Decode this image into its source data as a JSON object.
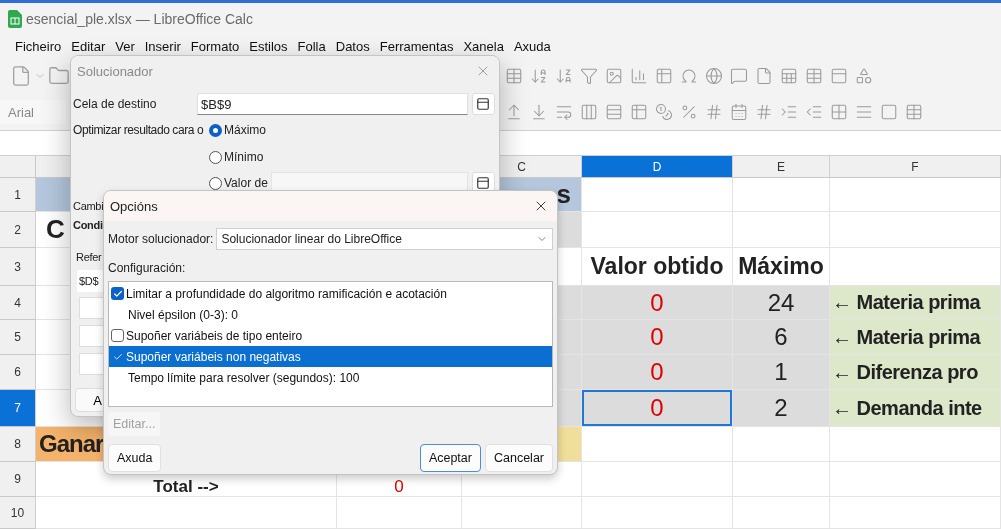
{
  "window": {
    "title": "esencial_ple.xlsx — LibreOffice Calc"
  },
  "menu": [
    "Ficheiro",
    "Editar",
    "Ver",
    "Inserir",
    "Formato",
    "Estilos",
    "Folla",
    "Datos",
    "Ferramentas",
    "Xanela",
    "Axuda"
  ],
  "font_name": {
    "value": "Arial"
  },
  "sheet": {
    "columns": [
      {},
      {},
      {
        "label": "C",
        "selected": false
      },
      {
        "label": "D",
        "selected": true
      },
      {
        "label": "E",
        "selected": false
      },
      {
        "label": "F",
        "selected": false
      }
    ],
    "rows": [
      {
        "label": "1",
        "selected": false,
        "cells": [
          {
            "kind": "band"
          },
          {
            "kind": "band"
          },
          {
            "kind": "band",
            "text": "s"
          },
          {
            "kind": "plain",
            "selected": false
          },
          {
            "kind": "plain",
            "selected": false
          },
          {
            "kind": "plain",
            "selected": false
          }
        ]
      },
      {
        "label": "2",
        "selected": false,
        "cells": [
          {
            "kind": "title",
            "text": "C"
          },
          {
            "kind": "plain"
          },
          {
            "kind": "shade"
          },
          {
            "kind": "plain",
            "selected": false
          },
          {
            "kind": "plain",
            "selected": false
          },
          {
            "kind": "plain",
            "selected": false
          }
        ]
      },
      {
        "label": "3",
        "selected": false,
        "cells": [
          {
            "kind": "plain"
          },
          {
            "kind": "plain"
          },
          {
            "kind": "plain"
          },
          {
            "kind": "heading",
            "text": "Valor obtido",
            "selected": false
          },
          {
            "kind": "heading",
            "text": "Máximo",
            "selected": false
          },
          {
            "kind": "plain",
            "selected": false
          }
        ]
      },
      {
        "label": "4",
        "selected": false,
        "cells": [
          {
            "kind": "plain"
          },
          {
            "kind": "plain"
          },
          {
            "kind": "shade"
          },
          {
            "kind": "value",
            "text": "0",
            "selected": false
          },
          {
            "kind": "bound",
            "text": "24",
            "selected": false
          },
          {
            "kind": "note",
            "text": "← Materia prima",
            "selected": false
          }
        ]
      },
      {
        "label": "5",
        "selected": false,
        "cells": [
          {
            "kind": "plain"
          },
          {
            "kind": "plain"
          },
          {
            "kind": "shade"
          },
          {
            "kind": "value",
            "text": "0",
            "selected": false
          },
          {
            "kind": "bound",
            "text": "6",
            "selected": false
          },
          {
            "kind": "note",
            "text": "← Materia prima",
            "selected": false
          }
        ]
      },
      {
        "label": "6",
        "selected": false,
        "cells": [
          {
            "kind": "plain"
          },
          {
            "kind": "plain"
          },
          {
            "kind": "shade"
          },
          {
            "kind": "value",
            "text": "0",
            "selected": false
          },
          {
            "kind": "bound",
            "text": "1",
            "selected": false
          },
          {
            "kind": "note",
            "text": "← Diferenza pro",
            "selected": false
          }
        ]
      },
      {
        "label": "7",
        "selected": true,
        "cells": [
          {
            "kind": "plain"
          },
          {
            "kind": "plain"
          },
          {
            "kind": "shade"
          },
          {
            "kind": "value",
            "text": "0",
            "selected": true
          },
          {
            "kind": "bound",
            "text": "2",
            "selected": false
          },
          {
            "kind": "note",
            "text": "← Demanda inte",
            "selected": false
          }
        ]
      },
      {
        "label": "8",
        "selected": false,
        "cells": [
          {
            "kind": "highlight",
            "text": "Ganar"
          },
          {
            "kind": "plain"
          },
          {
            "kind": "accent"
          },
          {
            "kind": "plain",
            "selected": false
          },
          {
            "kind": "plain",
            "selected": false
          },
          {
            "kind": "plain",
            "selected": false
          }
        ]
      },
      {
        "label": "9",
        "selected": false,
        "cells": [
          {
            "kind": "total",
            "text": "Total -->"
          },
          {
            "kind": "sum",
            "text": "0"
          },
          {
            "kind": "plain"
          },
          {
            "kind": "plain",
            "selected": false
          },
          {
            "kind": "plain",
            "selected": false
          },
          {
            "kind": "plain",
            "selected": false
          }
        ]
      },
      {
        "label": "10",
        "selected": false,
        "cells": [
          {
            "kind": "plain"
          },
          {
            "kind": "plain"
          },
          {
            "kind": "plain"
          },
          {
            "kind": "plain",
            "selected": false
          },
          {
            "kind": "plain",
            "selected": false
          },
          {
            "kind": "plain",
            "selected": false
          }
        ]
      }
    ]
  },
  "solver_dialog": {
    "title": "Solucionador",
    "target_label": "Cela de destino",
    "target_value": "$B$9",
    "optimize_label": "Optimizar resultado cara o",
    "options": [
      {
        "label": "Máximo",
        "selected": true
      },
      {
        "label": "Mínimo",
        "selected": false
      },
      {
        "label": "Valor de",
        "selected": false
      }
    ],
    "variables_label": "Cambi",
    "conditions_label": "Condi",
    "reference_label": "Refer",
    "reference_value": "$D$",
    "partial_button": "A"
  },
  "options_dialog": {
    "title": "Opcións",
    "engine_label": "Motor solucionador:",
    "engine_value": "Solucionador linear do LibreOffice",
    "settings_label": "Configuración:",
    "settings": [
      {
        "kind": "checkbox",
        "label": "Limitar a profundidade do algoritmo ramificación e acotación",
        "checked": true,
        "selected": false
      },
      {
        "kind": "value",
        "label": "Nivel épsilon (0-3): 0",
        "selected": false
      },
      {
        "kind": "checkbox",
        "label": "Supoñer variábeis de tipo enteiro",
        "checked": false,
        "selected": false
      },
      {
        "kind": "checkbox",
        "label": "Supoñer variábeis non negativas",
        "checked": true,
        "selected": true
      },
      {
        "kind": "value",
        "label": "Tempo límite para resolver (segundos): 100",
        "selected": false
      }
    ],
    "edit_button": {
      "label": "Editar...",
      "disabled": true
    },
    "buttons": [
      {
        "label": "Axuda",
        "default": false
      },
      {
        "label": "Aceptar",
        "default": true
      },
      {
        "label": "Cancelar",
        "default": false
      }
    ]
  }
}
